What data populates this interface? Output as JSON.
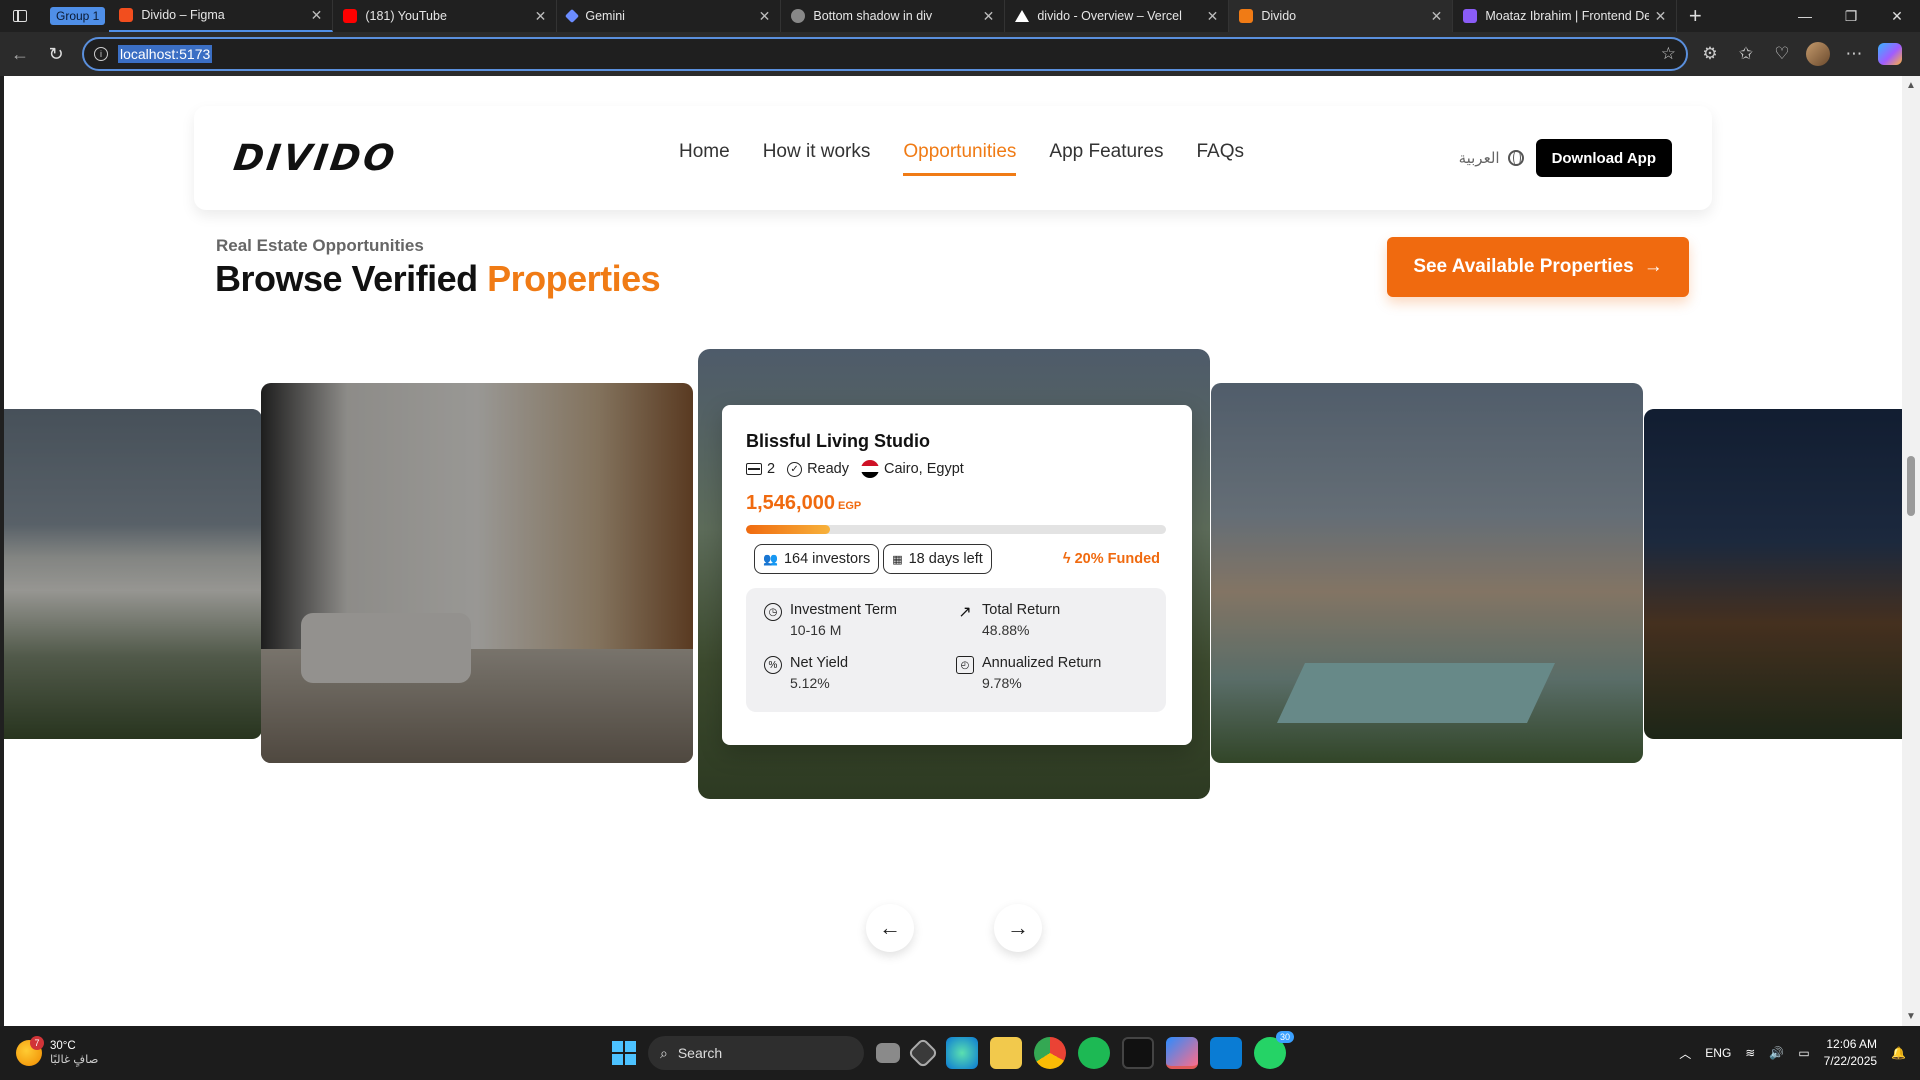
{
  "browser": {
    "tab_group_label": "Group 1",
    "tabs": [
      {
        "title": "Divido – Figma",
        "favicon_color": "#f24e1e"
      },
      {
        "title": "(181) YouTube",
        "favicon_color": "#ff0000"
      },
      {
        "title": "Gemini",
        "favicon_color": "#6b8cff"
      },
      {
        "title": "Bottom shadow in div",
        "favicon_color": "#888888"
      },
      {
        "title": "divido - Overview – Vercel",
        "favicon_color": "#ffffff"
      },
      {
        "title": "Divido",
        "favicon_color": "#f07b15"
      },
      {
        "title": "Moataz Ibrahim | Frontend Dev",
        "favicon_color": "#8a5cf6"
      }
    ],
    "url": "localhost:5173"
  },
  "site": {
    "logo_text": "DIVIDO",
    "nav": [
      {
        "label": "Home"
      },
      {
        "label": "How it works"
      },
      {
        "label": "Opportunities"
      },
      {
        "label": "App Features"
      },
      {
        "label": "FAQs"
      }
    ],
    "active_nav": "Opportunities",
    "language_label": "العربية",
    "download_label": "Download App",
    "accent_color": "#f07b15"
  },
  "section": {
    "eyebrow": "Real Estate Opportunities",
    "heading_main": "Browse Verified",
    "heading_accent": "Properties",
    "cta_label": "See Available Properties",
    "cta_icon": "arrow-right-icon"
  },
  "property": {
    "title": "Blissful Living Studio",
    "bedrooms": "2",
    "status": "Ready",
    "location": "Cairo, Egypt",
    "price": "1,546,000",
    "currency": "EGP",
    "funded_fraction": 0.2,
    "investors": "164 investors",
    "days_left": "18 days left",
    "funded_label": "20% Funded",
    "stats": [
      {
        "label": "Investment Term",
        "value": "10-16 M",
        "icon": "clock-icon"
      },
      {
        "label": "Total Return",
        "value": "48.88%",
        "icon": "trend-up-icon"
      },
      {
        "label": "Net Yield",
        "value": "5.12%",
        "icon": "percent-icon"
      },
      {
        "label": "Annualized Return",
        "value": "9.78%",
        "icon": "calendar-clock-icon"
      }
    ]
  },
  "taskbar": {
    "weather_temp": "30°C",
    "weather_desc": "صافٍ غالبًا",
    "weather_badge": "7",
    "search_label": "Search",
    "whatsapp_badge": "30",
    "language": "ENG",
    "time": "12:06 AM",
    "date": "7/22/2025"
  }
}
